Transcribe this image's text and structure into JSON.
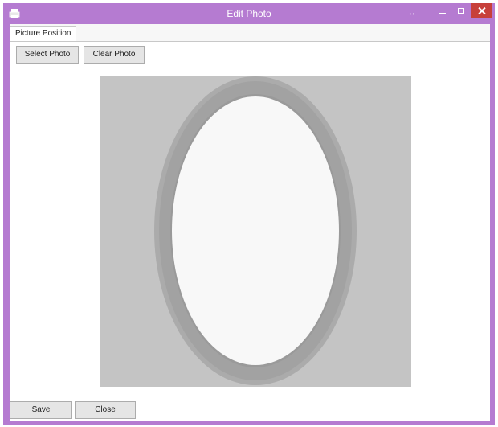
{
  "window": {
    "title": "Edit Photo",
    "accent": "#b57bd1",
    "close_color": "#c7403a"
  },
  "tabs": [
    {
      "label": "Picture Position"
    }
  ],
  "toolbar": {
    "select_label": "Select Photo",
    "clear_label": "Clear Photo"
  },
  "footer": {
    "save_label": "Save",
    "close_label": "Close"
  },
  "icons": {
    "app": "printer-icon",
    "resize": "resize-arrows-icon",
    "minimize": "minimize-icon",
    "maximize": "maximize-icon",
    "close": "close-icon"
  }
}
